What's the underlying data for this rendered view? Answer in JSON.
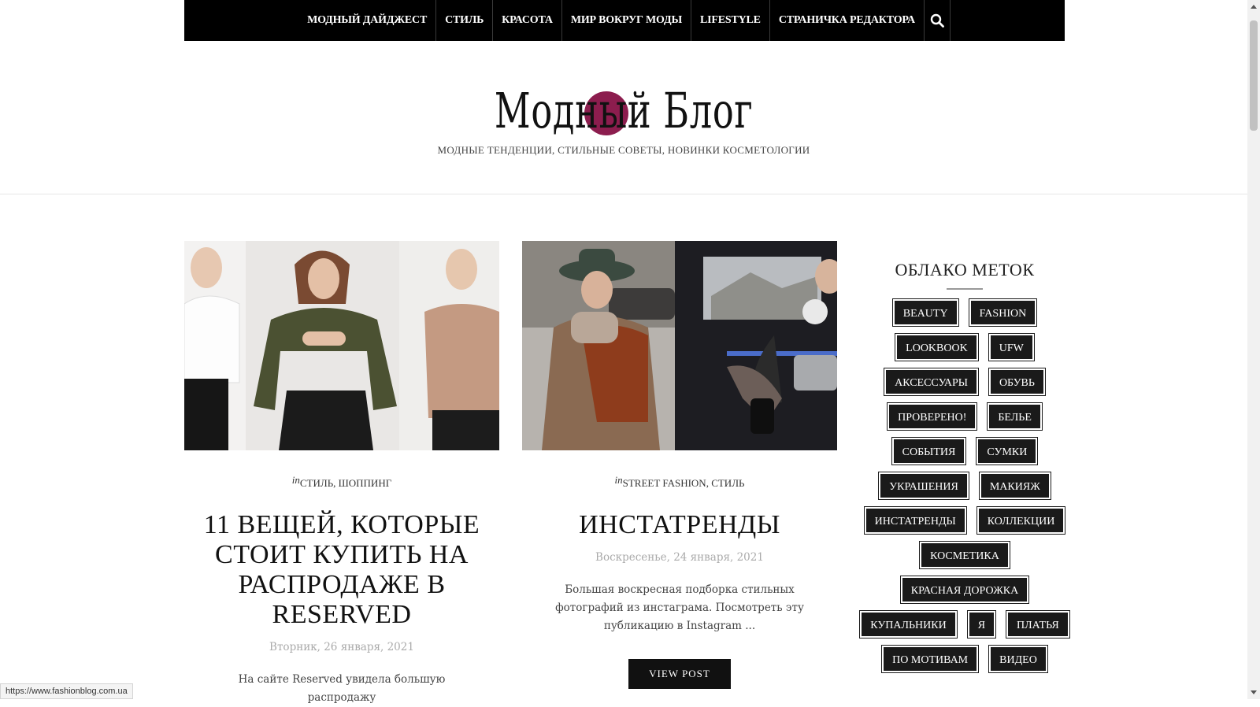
{
  "nav": {
    "items": [
      "МОДНЫЙ ДАЙДЖЕСТ",
      "СТИЛЬ",
      "КРАСОТА",
      "МИР ВОКРУГ МОДЫ",
      "LIFESTYLE",
      "СТРАНИЧКА РЕДАКТОРА"
    ],
    "search_icon": "search-icon"
  },
  "logo": {
    "text": "Модный Блог",
    "accent_color": "#8c1d4e"
  },
  "tagline": "МОДНЫЕ ТЕНДЕНЦИИ, СТИЛЬНЫЕ СОВЕТЫ, НОВИНКИ КОСМЕТОЛОГИИ",
  "posts": [
    {
      "in": "in",
      "categories": "СТИЛЬ, ШОППИНГ",
      "title": "11 ВЕЩЕЙ, КОТОРЫЕ СТОИТ КУПИТЬ НА РАСПРОДАЖЕ В RESERVED",
      "date": "Вторник, 26 января, 2021",
      "excerpt": "На сайте Reserved увидела большую распродажу"
    },
    {
      "in": "in",
      "categories": "STREET FASHION, СТИЛЬ",
      "title": "ИНСТАТРЕНДЫ",
      "date": "Воскресенье, 24 января, 2021",
      "excerpt": "Большая воскресная подборка стильных фотографий из инстаграма. Посмотреть эту публикацию в Instagram ...",
      "button": "VIEW POST"
    }
  ],
  "sidebar": {
    "title": "ОБЛАКО МЕТОК",
    "tag_rows": [
      [
        "BEAUTY",
        "FASHION"
      ],
      [
        "LOOKBOOK",
        "UFW"
      ],
      [
        "АКСЕССУАРЫ",
        "ОБУВЬ"
      ],
      [
        "ПРОВЕРЕНО!",
        "БЕЛЬЕ"
      ],
      [
        "СОБЫТИЯ",
        "СУМКИ"
      ],
      [
        "УКРАШЕНИЯ",
        "МАКИЯЖ"
      ],
      [
        "ИНСТАТРЕНДЫ",
        "КОЛЛЕКЦИИ"
      ],
      [
        "КОСМЕТИКА"
      ],
      [
        "КРАСНАЯ ДОРОЖКА"
      ],
      [
        "КУПАЛЬНИКИ",
        "Я",
        "ПЛАТЬЯ"
      ],
      [
        "ПО МОТИВАМ",
        "ВИДЕО"
      ]
    ]
  },
  "status_url": "https://www.fashionblog.com.ua"
}
